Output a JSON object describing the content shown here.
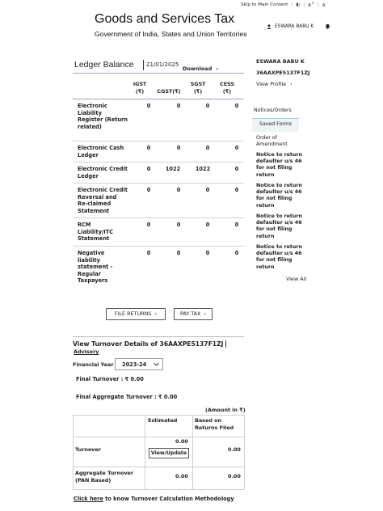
{
  "header": {
    "skip_link": "Skip to Main Content",
    "a_minus": "A",
    "a_plus": "A",
    "title": "Goods and Services Tax",
    "subtitle": "Government of India, States and Union Territories",
    "user": "ESWARA BABU K"
  },
  "ledger": {
    "title": "Ledger Balance",
    "date": "21/01/2025",
    "download": "Download",
    "columns": [
      "IGST (₹)",
      "CGST(₹)",
      "SGST (₹)",
      "CESS (₹)"
    ],
    "column_lines": [
      [
        "IGST",
        "(₹)"
      ],
      [
        "CGST(₹)"
      ],
      [
        "SGST",
        "(₹)"
      ],
      [
        "CESS",
        "(₹)"
      ]
    ],
    "rows": [
      {
        "label": "Electronic Liability Register (Return related)",
        "values": [
          "0",
          "0",
          "0",
          "0"
        ]
      },
      {
        "label": "Electronic Cash Ledger",
        "values": [
          "0",
          "0",
          "0",
          "0"
        ]
      },
      {
        "label": "Electronic Credit Ledger",
        "values": [
          "0",
          "1022",
          "1022",
          "0"
        ]
      },
      {
        "label": "Electronic Credit Reversal and Re-claimed Statement",
        "values": [
          "0",
          "0",
          "0",
          "0"
        ]
      },
      {
        "label": "RCM Liability/ITC Statement",
        "values": [
          "0",
          "0",
          "0",
          "0"
        ]
      },
      {
        "label": "Negative liability statement - Regular Taxpayers",
        "values": [
          "0",
          "0",
          "0",
          "0"
        ]
      }
    ]
  },
  "sidebar": {
    "name": "ESWARA BABU K",
    "gstin": "36AAXPE5137F1ZJ",
    "view_profile": "View Profile",
    "tabs": [
      "Notices/Orders",
      "Saved Forms"
    ],
    "order_label": "Order of Amendment",
    "notices": [
      "Notice to return defaulter u/s 46 for not filing return",
      "Notice to return defaulter u/s 46 for not filing return",
      "Notice to return defaulter u/s 46 for not filing return",
      "Notice to return defaulter u/s 46 for not filing return"
    ],
    "view_all": "View All"
  },
  "actions": {
    "file_returns": "FILE RETURNS",
    "pay_tax": "PAY TAX"
  },
  "turnover": {
    "title_prefix": "View Turnover Details of",
    "gstin": "36AAXPE5137F1ZJ",
    "advisory": "Advisory",
    "fy_label": "Financial Year",
    "fy_value": "2023-24",
    "final_turnover": "Final Turnover : ₹ 0.00",
    "final_aggregate": "Final Aggregate Turnover : ₹ 0.00",
    "amount_note": "(Amount in ₹)",
    "col_estimated": "Estimated",
    "col_returns": "Based on Returns Filed",
    "row_turnover": "Turnover",
    "row_aggregate": "Aggregate Turnover (PAN Based)",
    "turnover_estimated": "0.00",
    "turnover_returns": "0.00",
    "aggregate_estimated": "0.00",
    "aggregate_returns": "0.00",
    "view_update": "View/Update",
    "click_here": "Click here",
    "methodology": "to know Turnover Calculation Methodology"
  },
  "icons": {
    "user": "user-icon",
    "bell": "bell-icon",
    "chevron": "chevron-right-icon",
    "dropdown": "chevron-down-icon"
  }
}
